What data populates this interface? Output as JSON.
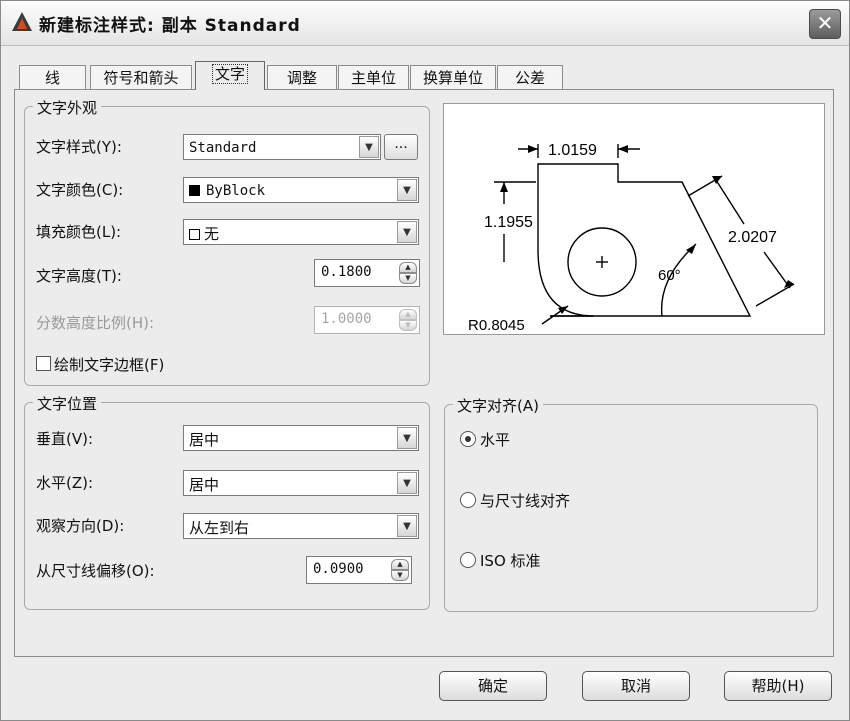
{
  "window": {
    "title": "新建标注样式: 副本 Standard"
  },
  "tabs": [
    "线",
    "符号和箭头",
    "文字",
    "调整",
    "主单位",
    "换算单位",
    "公差"
  ],
  "active_tab": "文字",
  "text_appearance": {
    "group_title": "文字外观",
    "style_label": "文字样式(Y):",
    "style_value": "Standard",
    "ellipsis": "...",
    "color_label": "文字颜色(C):",
    "color_value": "ByBlock",
    "fill_label": "填充颜色(L):",
    "fill_value": "无",
    "height_label": "文字高度(T):",
    "height_value": "0.1800",
    "fraction_label": "分数高度比例(H):",
    "fraction_value": "1.0000",
    "frame_label": "绘制文字边框(F)"
  },
  "text_placement": {
    "group_title": "文字位置",
    "vertical_label": "垂直(V):",
    "vertical_value": "居中",
    "horizontal_label": "水平(Z):",
    "horizontal_value": "居中",
    "view_dir_label": "观察方向(D):",
    "view_dir_value": "从左到右",
    "offset_label": "从尺寸线偏移(O):",
    "offset_value": "0.0900"
  },
  "text_alignment": {
    "group_title": "文字对齐(A)",
    "options": [
      "水平",
      "与尺寸线对齐",
      "ISO 标准"
    ],
    "selected": "水平"
  },
  "preview": {
    "dim_top": "1.0159",
    "dim_left": "1.1955",
    "dim_right": "2.0207",
    "angle": "60°",
    "radius": "R0.8045"
  },
  "buttons": {
    "ok": "确定",
    "cancel": "取消",
    "help": "帮助(H)"
  }
}
